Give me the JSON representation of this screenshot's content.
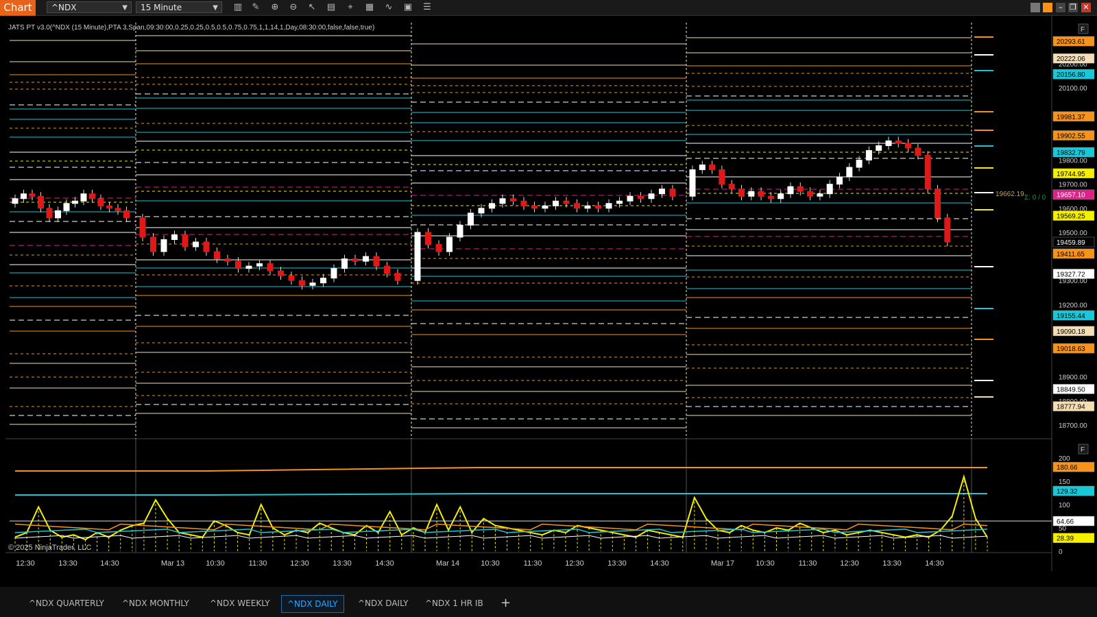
{
  "toolbar": {
    "chart_label": "Chart",
    "instrument": "^NDX",
    "interval": "15 Minute"
  },
  "indicator_label": "JATS PT v3.0(^NDX (15 Minute),PTA 3,Span,09:30:00,0.25,0.25,0.5,0.5,0.75,0.75,1,1,14,1,Day,08:30:00,false,false,true)",
  "copyright": "© 2025 NinjaTrader, LLC",
  "price_axis": {
    "ticks": [
      "20200.00",
      "20100.00",
      "19800.00",
      "19700.00",
      "19600.00",
      "19500.00",
      "19300.00",
      "19200.00",
      "18900.00",
      "18800.00",
      "18700.00"
    ],
    "tick_values": [
      20200,
      20100,
      19800,
      19700,
      19600,
      19500,
      19300,
      19200,
      18900,
      18800,
      18700
    ],
    "labels": [
      {
        "text": "20293.61",
        "value": 20293.61,
        "color": "#f7931a",
        "fg": "#000"
      },
      {
        "text": "20222.06",
        "value": 20222.06,
        "color": "#f5deb3",
        "fg": "#000"
      },
      {
        "text": "20156.80",
        "value": 20156.8,
        "color": "#18c8d8",
        "fg": "#000"
      },
      {
        "text": "19981.37",
        "value": 19981.37,
        "color": "#f7931a",
        "fg": "#000"
      },
      {
        "text": "19902.55",
        "value": 19902.55,
        "color": "#f7931a",
        "fg": "#000"
      },
      {
        "text": "19832.79",
        "value": 19832.79,
        "color": "#18c8d8",
        "fg": "#000"
      },
      {
        "text": "19744.95",
        "value": 19744.95,
        "color": "#f5f000",
        "fg": "#000"
      },
      {
        "text": "19657.10",
        "value": 19657.1,
        "color": "#e0208a",
        "fg": "#fff"
      },
      {
        "text": "19569.25",
        "value": 19569.25,
        "color": "#f5f000",
        "fg": "#000"
      },
      {
        "text": "19459.89",
        "value": 19459.89,
        "color": "#000",
        "fg": "#fff"
      },
      {
        "text": "19411.65",
        "value": 19411.65,
        "color": "#f7931a",
        "fg": "#000"
      },
      {
        "text": "19327.72",
        "value": 19327.72,
        "color": "#fff",
        "fg": "#000"
      },
      {
        "text": "19155.44",
        "value": 19155.44,
        "color": "#18c8d8",
        "fg": "#000"
      },
      {
        "text": "19090.18",
        "value": 19090.18,
        "color": "#f5deb3",
        "fg": "#000"
      },
      {
        "text": "19018.63",
        "value": 19018.63,
        "color": "#f7931a",
        "fg": "#000"
      },
      {
        "text": "18849.50",
        "value": 18849.5,
        "color": "#fff",
        "fg": "#000"
      },
      {
        "text": "18777.94",
        "value": 18777.94,
        "color": "#f5deb3",
        "fg": "#000"
      }
    ],
    "float_label": {
      "text": "19662.19",
      "value": 19662.19,
      "color": "#c8a050"
    },
    "mini_label": "Σ: 0 / 0"
  },
  "indicator_axis": {
    "ticks": [
      "200",
      "150",
      "100",
      "50",
      "0"
    ],
    "tick_values": [
      200,
      150,
      100,
      50,
      0
    ],
    "labels": [
      {
        "text": "180.66",
        "value": 180.66,
        "color": "#f7931a",
        "fg": "#000"
      },
      {
        "text": "129.32",
        "value": 129.32,
        "color": "#18c8d8",
        "fg": "#000"
      },
      {
        "text": "64.66",
        "value": 64.66,
        "color": "#fff",
        "fg": "#000"
      },
      {
        "text": "28.39",
        "value": 28.39,
        "color": "#f5f000",
        "fg": "#000"
      }
    ]
  },
  "time_axis": [
    "12:30",
    "13:30",
    "14:30",
    "Mar 13",
    "10:30",
    "11:30",
    "12:30",
    "13:30",
    "14:30",
    "Mar 14",
    "10:30",
    "11:30",
    "12:30",
    "13:30",
    "14:30",
    "Mar 17",
    "10:30",
    "11:30",
    "12:30",
    "13:30",
    "14:30"
  ],
  "tabs": [
    {
      "label": "^NDX QUARTERLY",
      "active": false
    },
    {
      "label": "^NDX MONTHLY",
      "active": false
    },
    {
      "label": "^NDX WEEKLY",
      "active": false
    },
    {
      "label": "^NDX DAILY",
      "active": true
    },
    {
      "label": "^NDX DAILY",
      "active": false
    },
    {
      "label": "^NDX 1 HR IB",
      "active": false
    }
  ],
  "add_tab_label": "+",
  "f_button_label": "F"
}
